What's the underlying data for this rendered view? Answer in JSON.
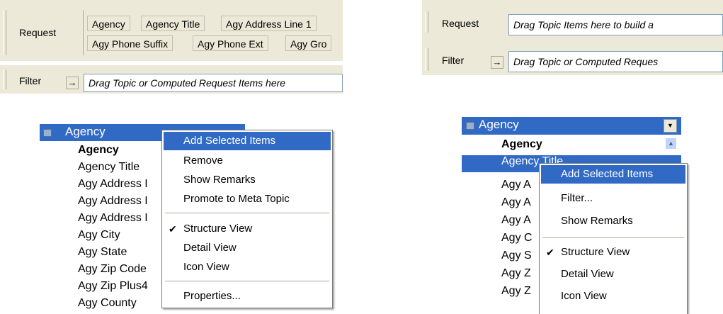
{
  "left": {
    "request_label": "Request",
    "request_chips": [
      "Agency",
      "Agency Title",
      "Agy Address Line 1",
      "Agy Phone Suffix",
      "Agy Phone Ext",
      "Agy Gro"
    ],
    "filter_label": "Filter",
    "filter_arrow": "→",
    "filter_placeholder": "Drag Topic or Computed Request Items here",
    "topic_title": "Agency",
    "dropdown_glyph": "▼",
    "items": [
      "Agency",
      "Agency Title",
      "Agy Address I",
      "Agy Address I",
      "Agy Address I",
      "Agy City",
      "Agy State",
      "Agy Zip Code",
      "Agy Zip Plus4",
      "Agy County"
    ],
    "menu": {
      "add": "Add Selected Items",
      "remove": "Remove",
      "show_remarks": "Show Remarks",
      "promote": "Promote to Meta Topic",
      "structure": "Structure View",
      "detail": "Detail View",
      "icon": "Icon View",
      "properties": "Properties...",
      "check_glyph": "✔"
    }
  },
  "right": {
    "request_label": "Request",
    "request_placeholder": "Drag Topic Items here to build a",
    "filter_label": "Filter",
    "filter_arrow": "→",
    "filter_placeholder": "Drag Topic or Computed Reques",
    "topic_title": "Agency",
    "dropdown_glyph": "▼",
    "scroll_glyph": "▲",
    "items": [
      "Agency",
      "Agency Title",
      "Agy A",
      "Agy A",
      "Agy A",
      "Agy C",
      "Agy S",
      "Agy Z",
      "Agy Z"
    ],
    "menu": {
      "add": "Add Selected Items",
      "filter": "Filter...",
      "show_remarks": "Show Remarks",
      "structure": "Structure View",
      "detail": "Detail View",
      "icon": "Icon View",
      "check_glyph": "✔"
    }
  }
}
